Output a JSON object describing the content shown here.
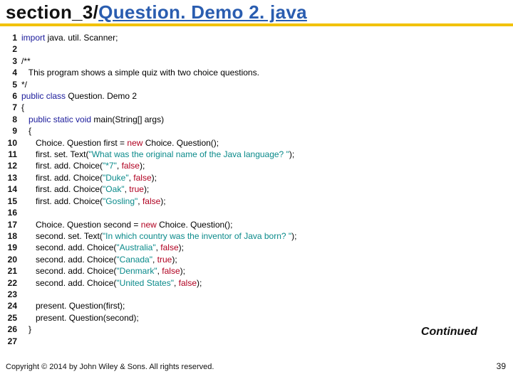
{
  "title": {
    "prefix": "section_3/",
    "link_text": "Question. Demo 2. java"
  },
  "code": {
    "lines": [
      {
        "n": "1",
        "html": "<span class='kw-blue'>import</span> java. util. Scanner;"
      },
      {
        "n": "2",
        "html": ""
      },
      {
        "n": "3",
        "html": "/**"
      },
      {
        "n": "4",
        "html": "   This program shows a simple quiz with two choice questions."
      },
      {
        "n": "5",
        "html": "*/"
      },
      {
        "n": "6",
        "html": "<span class='kw-blue'>public class</span> Question. Demo 2"
      },
      {
        "n": "7",
        "html": "{"
      },
      {
        "n": "8",
        "html": "   <span class='kw-blue'>public static void</span> main(String[] args)"
      },
      {
        "n": "9",
        "html": "   {"
      },
      {
        "n": "10",
        "html": "      Choice. Question first = <span class='kw-red'>new</span> Choice. Question();"
      },
      {
        "n": "11",
        "html": "      first. set. Text(<span class='kw-teal'>\"What was the original name of the Java language? \"</span>);"
      },
      {
        "n": "12",
        "html": "      first. add. Choice(<span class='kw-teal'>\"*7\"</span>, <span class='kw-red'>false</span>);"
      },
      {
        "n": "13",
        "html": "      first. add. Choice(<span class='kw-teal'>\"Duke\"</span>, <span class='kw-red'>false</span>);"
      },
      {
        "n": "14",
        "html": "      first. add. Choice(<span class='kw-teal'>\"Oak\"</span>, <span class='kw-red'>true</span>);"
      },
      {
        "n": "15",
        "html": "      first. add. Choice(<span class='kw-teal'>\"Gosling\"</span>, <span class='kw-red'>false</span>);"
      },
      {
        "n": "16",
        "html": ""
      },
      {
        "n": "17",
        "html": "      Choice. Question second = <span class='kw-red'>new</span> Choice. Question();"
      },
      {
        "n": "18",
        "html": "      second. set. Text(<span class='kw-teal'>\"In which country was the inventor of Java born? \"</span>);"
      },
      {
        "n": "19",
        "html": "      second. add. Choice(<span class='kw-teal'>\"Australia\"</span>, <span class='kw-red'>false</span>);"
      },
      {
        "n": "20",
        "html": "      second. add. Choice(<span class='kw-teal'>\"Canada\"</span>, <span class='kw-red'>true</span>);"
      },
      {
        "n": "21",
        "html": "      second. add. Choice(<span class='kw-teal'>\"Denmark\"</span>, <span class='kw-red'>false</span>);"
      },
      {
        "n": "22",
        "html": "      second. add. Choice(<span class='kw-teal'>\"United States\"</span>, <span class='kw-red'>false</span>);"
      },
      {
        "n": "23",
        "html": ""
      },
      {
        "n": "24",
        "html": "      present. Question(first);"
      },
      {
        "n": "25",
        "html": "      present. Question(second);"
      },
      {
        "n": "26",
        "html": "   }"
      },
      {
        "n": "27",
        "html": ""
      }
    ]
  },
  "continued": "Continued",
  "copyright": "Copyright © 2014 by John Wiley & Sons. All rights reserved.",
  "page_number": "39"
}
